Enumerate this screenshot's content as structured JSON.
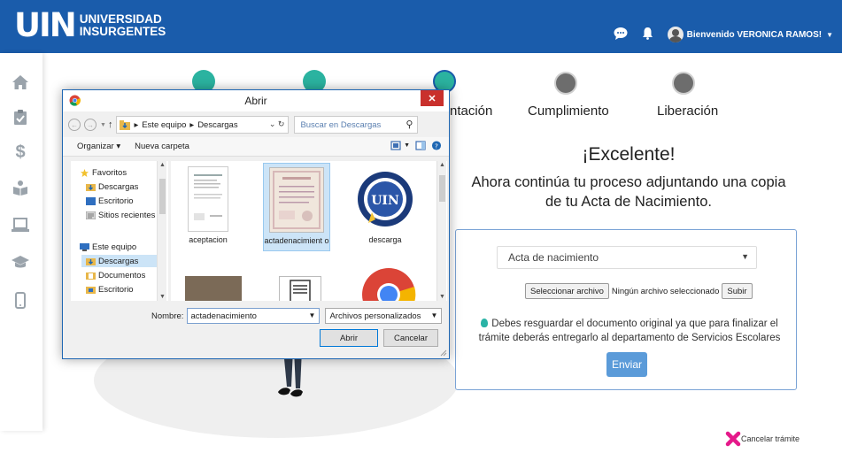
{
  "app": {
    "logo_mark": "UIN",
    "logo_line1": "UNIVERSIDAD",
    "logo_line2": "INSURGENTES",
    "welcome": "Bienvenido VERONICA RAMOS!"
  },
  "steps": [
    {
      "label": "ntación"
    },
    {
      "label": "Cumplimiento"
    },
    {
      "label": "Liberación"
    }
  ],
  "main": {
    "title": "¡Excelente!",
    "subtitle_line1": "Ahora continúa tu proceso adjuntando una copia",
    "subtitle_line2": "de tu Acta de Nacimiento.",
    "document_select": "Acta de nacimiento",
    "select_file_label": "Seleccionar archivo",
    "no_file_text": "Ningún archivo seleccionado",
    "upload_label": "Subir",
    "note_line1": "Debes resguardar el documento original ya que para finalizar el",
    "note_line2": "trámite deberás entregarlo al departamento de Servicios Escolares",
    "send_label": "Enviar",
    "cancel_label": "Cancelar trámite"
  },
  "dialog": {
    "title": "Abrir",
    "breadcrumb": [
      "Este equipo",
      "Descargas"
    ],
    "search_placeholder": "Buscar en Descargas",
    "organize_label": "Organizar",
    "new_folder_label": "Nueva carpeta",
    "nav_items": [
      {
        "label": "Favoritos"
      },
      {
        "label": "Descargas"
      },
      {
        "label": "Escritorio"
      },
      {
        "label": "Sitios recientes"
      },
      {
        "label": "Este equipo"
      },
      {
        "label": "Descargas"
      },
      {
        "label": "Documentos"
      },
      {
        "label": "Escritorio"
      }
    ],
    "files": [
      {
        "name": "aceptacion"
      },
      {
        "name": "actadenacimient o"
      },
      {
        "name": "descarga"
      }
    ],
    "filename_label": "Nombre:",
    "filename_value": "actadenacimiento",
    "filter_value": "Archivos personalizados",
    "open_label": "Abrir",
    "cancel_label": "Cancelar"
  },
  "colors": {
    "header": "#1a5cab",
    "send_button": "#5b9bd9",
    "panel_border": "#7aa3d6",
    "cancel_x": "#e5198a"
  }
}
